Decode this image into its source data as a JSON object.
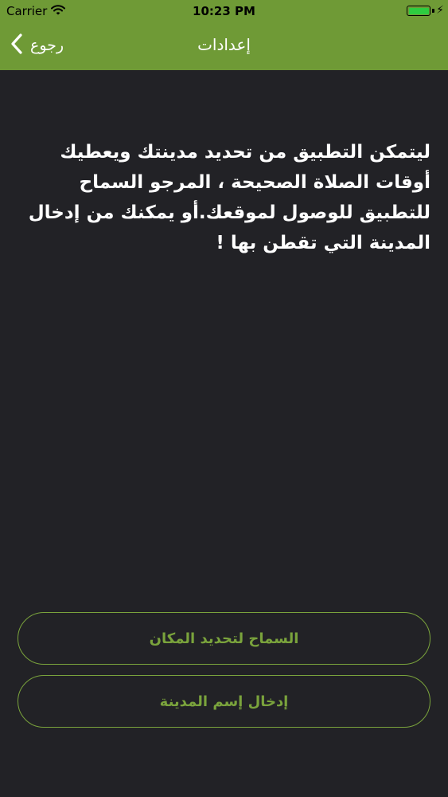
{
  "status_bar": {
    "carrier": "Carrier",
    "time": "10:23 PM",
    "battery_level": 1.0,
    "battery_color": "#2ecc40"
  },
  "nav": {
    "back_label": "رجوع",
    "title": "إعدادات",
    "bar_color": "#6f9a36"
  },
  "main": {
    "message": "ليتمكن التطبيق من تحديد مدينتك ويعطيك أوقات الصلاة الصحيحة ، المرجو السماح للتطبيق للوصول لموقعك.أو يمكنك من إدخال المدينة التي تقطن بها !"
  },
  "buttons": {
    "allow_location": "السماح لتحديد المكان",
    "enter_city": "إدخال إسم المدينة"
  },
  "colors": {
    "background": "#222226",
    "accent": "#7aa33c"
  }
}
